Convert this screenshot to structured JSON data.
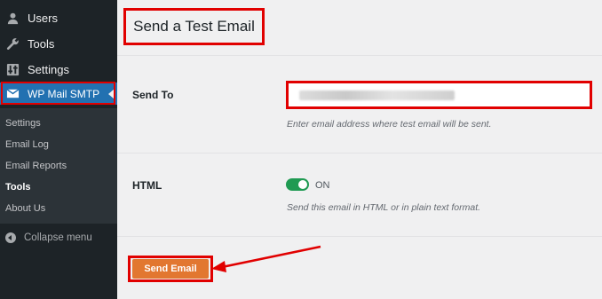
{
  "sidebar": {
    "menu": [
      {
        "label": "Users",
        "icon": "user-icon"
      },
      {
        "label": "Tools",
        "icon": "wrench-icon"
      },
      {
        "label": "Settings",
        "icon": "settings-icon"
      },
      {
        "label": "WP Mail SMTP",
        "icon": "mail-icon"
      }
    ],
    "submenu": [
      "Settings",
      "Email Log",
      "Email Reports",
      "Tools",
      "About Us"
    ],
    "collapse_label": "Collapse menu"
  },
  "main": {
    "title": "Send a Test Email",
    "send_to_label": "Send To",
    "send_to_hint": "Enter email address where test email will be sent.",
    "html_label": "HTML",
    "toggle_state": "ON",
    "html_hint": "Send this email in HTML or in plain text format.",
    "send_button": "Send Email"
  },
  "colors": {
    "sidebar_bg": "#1d2327",
    "active_bg": "#2271b1",
    "highlight": "#e10000",
    "toggle_on": "#1f9a52",
    "button": "#e27730"
  }
}
